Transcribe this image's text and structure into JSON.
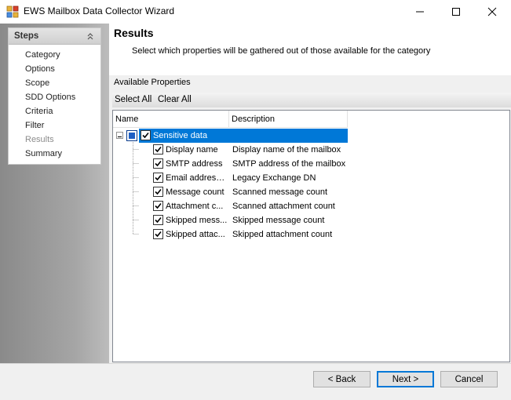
{
  "window": {
    "title": "EWS Mailbox Data Collector Wizard"
  },
  "steps": {
    "title": "Steps",
    "items": [
      {
        "label": "Category",
        "current": false
      },
      {
        "label": "Options",
        "current": false
      },
      {
        "label": "Scope",
        "current": false
      },
      {
        "label": "SDD Options",
        "current": false
      },
      {
        "label": "Criteria",
        "current": false
      },
      {
        "label": "Filter",
        "current": false
      },
      {
        "label": "Results",
        "current": true
      },
      {
        "label": "Summary",
        "current": false
      }
    ]
  },
  "page": {
    "title": "Results",
    "subtitle": "Select which properties will be gathered out of those available for the category"
  },
  "properties": {
    "label": "Available Properties",
    "select_all": "Select All",
    "clear_all": "Clear All",
    "columns": {
      "name": "Name",
      "description": "Description"
    },
    "root": {
      "name": "Sensitive data",
      "checked": true,
      "expanded": true
    },
    "items": [
      {
        "name": "Display name",
        "description": "Display name of the mailbox",
        "checked": true
      },
      {
        "name": "SMTP address",
        "description": "SMTP address of the mailbox",
        "checked": true
      },
      {
        "name": "Email address ...",
        "description": "Legacy Exchange DN",
        "checked": true
      },
      {
        "name": "Message count",
        "description": "Scanned message count",
        "checked": true
      },
      {
        "name": "Attachment c...",
        "description": "Scanned attachment count",
        "checked": true
      },
      {
        "name": "Skipped mess...",
        "description": "Skipped message count",
        "checked": true
      },
      {
        "name": "Skipped attac...",
        "description": "Skipped attachment count",
        "checked": true
      }
    ]
  },
  "buttons": {
    "back": "< Back",
    "next": "Next >",
    "cancel": "Cancel"
  },
  "colors": {
    "selection": "#0078d7",
    "steps_current": "#8c8c8c"
  }
}
